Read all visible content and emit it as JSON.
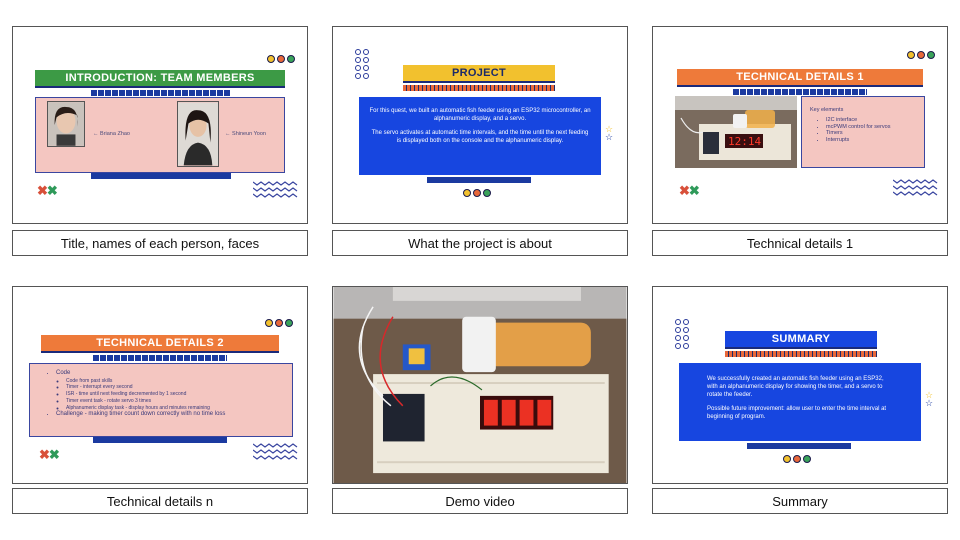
{
  "slides": [
    {
      "caption": "Title, names of each person, faces",
      "banner": "INTRODUCTION: TEAM MEMBERS",
      "person1": "← Briana Zhao",
      "person2": "← Shineun Yoon"
    },
    {
      "caption": "What the project is about",
      "banner": "PROJECT",
      "para1": "For this quest, we built an automatic fish feeder using an ESP32 microcontroller, an alphanumeric display, and a servo.",
      "para2": "The servo activates at automatic time intervals, and the time until the next feeding is displayed both on the console and the alphanumeric display."
    },
    {
      "caption": "Technical details 1",
      "banner": "TECHNICAL DETAILS 1",
      "key_title": "Key elements",
      "key_items": [
        "I2C interface",
        "mcPWM control for servos",
        "Timers",
        "Interrupts"
      ],
      "display_text": "12:14"
    },
    {
      "caption": "Technical details n",
      "banner": "TECHNICAL DETAILS 2",
      "code_label": "Code",
      "code_items": [
        "Code from past skills",
        "Timer - interrupt every second",
        "ISR - time until next feeding decremented by 1 second",
        "Timer event task - rotate servo 3 times",
        "Alphanumeric display task - display hours and minutes remaining"
      ],
      "challenge": "Challenge - making timer count down correctly with no time loss"
    },
    {
      "caption": "Demo video"
    },
    {
      "caption": "Summary",
      "banner": "SUMMARY",
      "para1": "We successfully created an automatic fish feeder using an ESP32, with an alphanumeric display for showing the timer, and a servo to rotate the feeder.",
      "para2": "Possible future improvement: allow user to enter the time interval at beginning of program."
    }
  ],
  "colors": {
    "green_banner": "#3c9a45",
    "yellow_banner": "#f2c12e",
    "orange_banner": "#ee7a3a",
    "blue_box": "#1746e0",
    "pink_box": "#f4c6c1",
    "navy": "#1b3aa0"
  }
}
